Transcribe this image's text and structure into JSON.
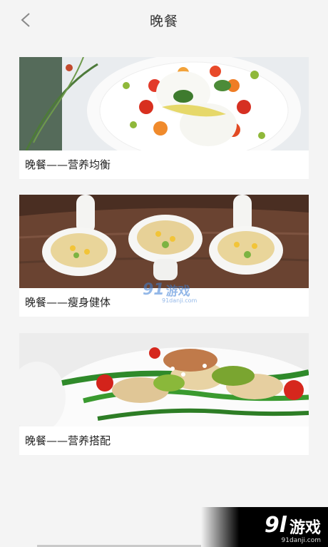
{
  "header": {
    "title": "晚餐"
  },
  "cards": [
    {
      "caption": "晚餐——营养均衡"
    },
    {
      "caption": "晚餐——瘦身健体"
    },
    {
      "caption": "晚餐——营养搭配"
    }
  ],
  "watermark": {
    "logo": "91",
    "text": "游戏",
    "url": "91danji.com"
  },
  "corner_badge": {
    "logo": "9l",
    "text": "游戏",
    "url": "91danji.com"
  }
}
